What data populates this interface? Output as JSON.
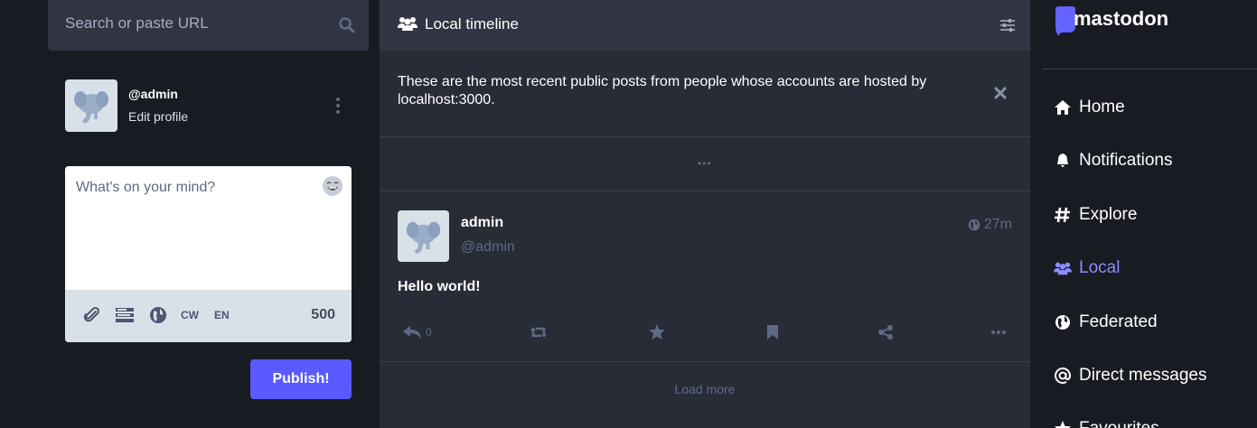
{
  "search": {
    "placeholder": "Search or paste URL"
  },
  "account": {
    "handle": "@admin",
    "edit_label": "Edit profile"
  },
  "composer": {
    "placeholder": "What's on your mind?",
    "cw_label": "CW",
    "lang_label": "EN",
    "char_count": "500",
    "publish_label": "Publish!"
  },
  "column": {
    "title": "Local timeline",
    "notice": "These are the most recent public posts from people whose accounts are hosted by localhost:3000.",
    "gap_label": "•••"
  },
  "status": {
    "display_name": "admin",
    "handle": "@admin",
    "time": "27m",
    "body": "Hello world!",
    "reply_count": "0"
  },
  "load_more": "Load more",
  "brand": {
    "name": "mastodon"
  },
  "nav": {
    "home": "Home",
    "notifications": "Notifications",
    "explore": "Explore",
    "local": "Local",
    "federated": "Federated",
    "direct": "Direct messages",
    "favourites": "Favourites"
  },
  "colors": {
    "accent": "#8c8dff",
    "publish": "#595aff",
    "background": "#191b22",
    "column": "#282c37",
    "header": "#313543"
  }
}
